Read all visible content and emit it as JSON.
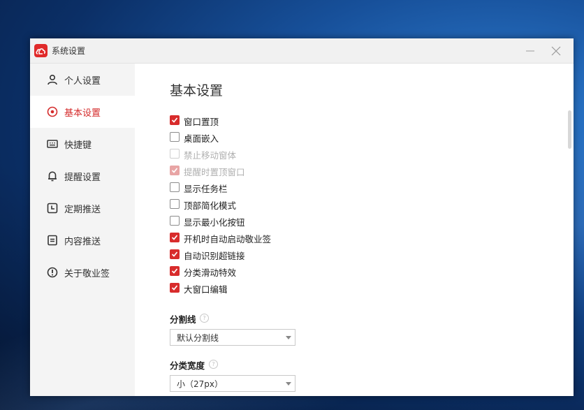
{
  "window": {
    "title": "系统设置"
  },
  "sidebar": {
    "items": [
      {
        "label": "个人设置",
        "icon": "user-icon",
        "active": false
      },
      {
        "label": "基本设置",
        "icon": "settings-circle-icon",
        "active": true
      },
      {
        "label": "快捷键",
        "icon": "keyboard-icon",
        "active": false
      },
      {
        "label": "提醒设置",
        "icon": "bell-icon",
        "active": false
      },
      {
        "label": "定期推送",
        "icon": "clock-icon",
        "active": false
      },
      {
        "label": "内容推送",
        "icon": "document-icon",
        "active": false
      },
      {
        "label": "关于敬业签",
        "icon": "info-icon",
        "active": false
      }
    ]
  },
  "main": {
    "title": "基本设置",
    "options": [
      {
        "label": "窗口置顶",
        "checked": true,
        "disabled": false
      },
      {
        "label": "桌面嵌入",
        "checked": false,
        "disabled": false
      },
      {
        "label": "禁止移动窗体",
        "checked": false,
        "disabled": true
      },
      {
        "label": "提醒时置顶窗口",
        "checked": true,
        "disabled": true
      },
      {
        "label": "显示任务栏",
        "checked": false,
        "disabled": false
      },
      {
        "label": "顶部简化模式",
        "checked": false,
        "disabled": false
      },
      {
        "label": "显示最小化按钮",
        "checked": false,
        "disabled": false
      },
      {
        "label": "开机时自动启动敬业签",
        "checked": true,
        "disabled": false
      },
      {
        "label": "自动识别超链接",
        "checked": true,
        "disabled": false
      },
      {
        "label": "分类滑动特效",
        "checked": true,
        "disabled": false
      },
      {
        "label": "大窗口编辑",
        "checked": true,
        "disabled": false
      }
    ],
    "divider": {
      "label": "分割线",
      "help": "?",
      "value": "默认分割线"
    },
    "category_width": {
      "label": "分类宽度",
      "help": "?",
      "value": "小（27px）"
    }
  },
  "colors": {
    "accent": "#d82c2c",
    "sidebar_bg": "#f4f4f4"
  }
}
